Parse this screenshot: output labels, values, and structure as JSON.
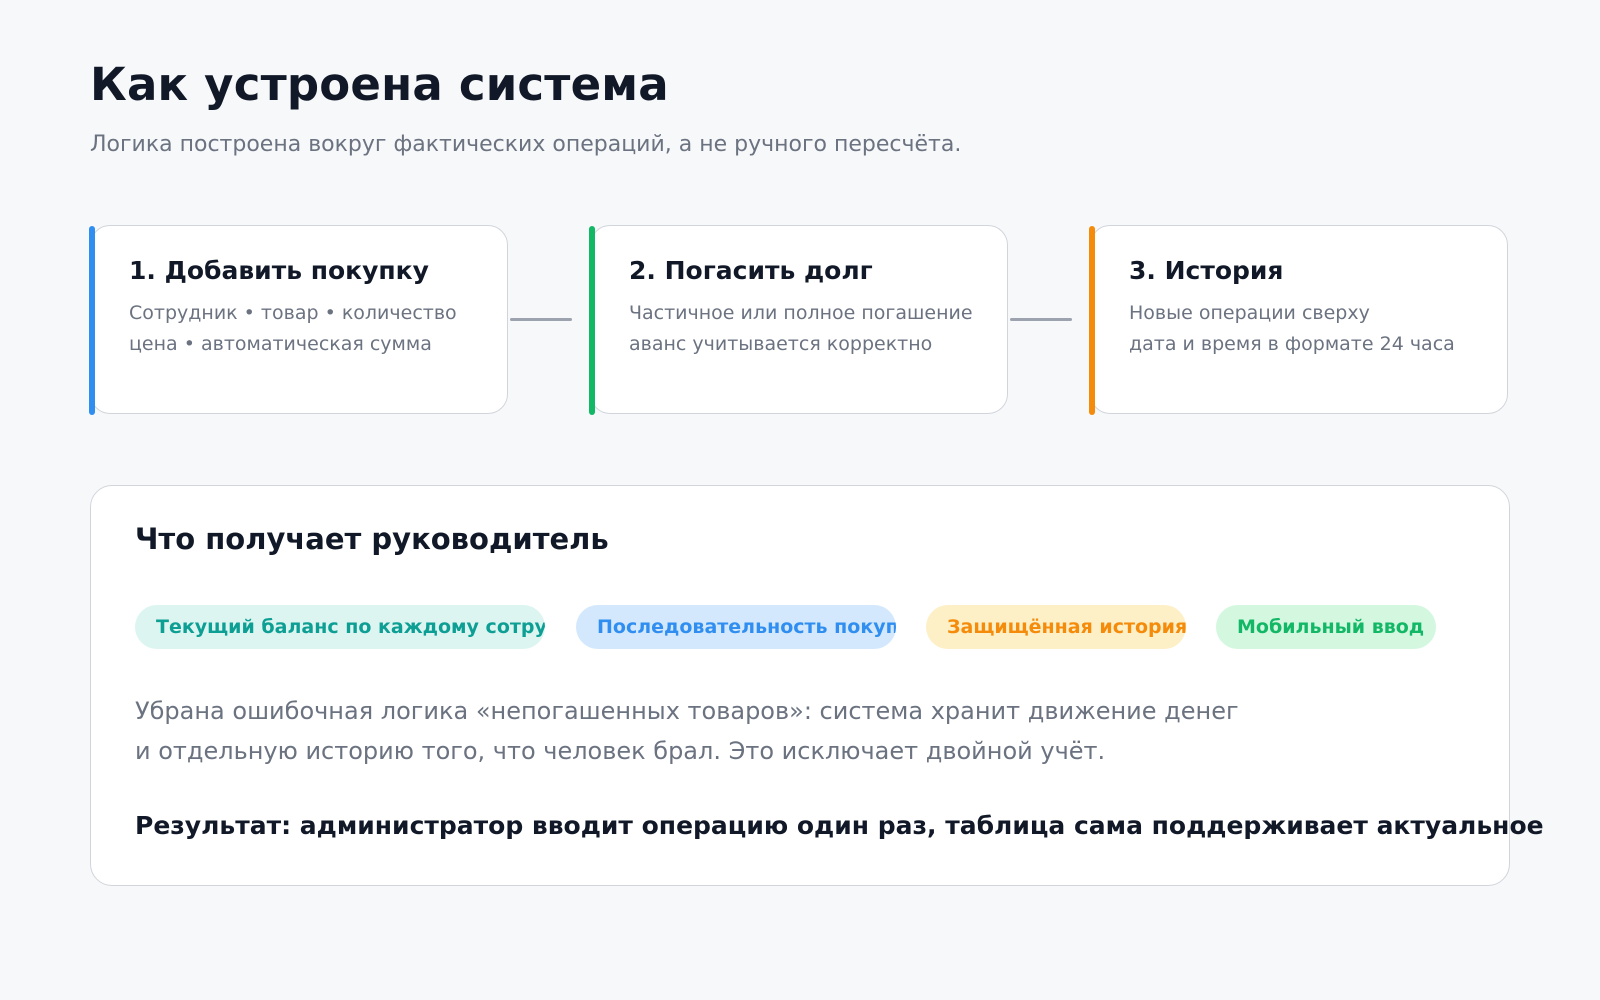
{
  "header": {
    "title": "Как устроена система",
    "subtitle": "Логика построена вокруг фактических операций, а не ручного пересчёта."
  },
  "steps": [
    {
      "title": "1. Добавить покупку",
      "line1": "Сотрудник • товар • количество",
      "line2": "цена • автоматическая сумма",
      "color": "#2f8ef0"
    },
    {
      "title": "2. Погасить долг",
      "line1": "Частичное или полное погашение",
      "line2": "аванс учитывается корректно",
      "color": "#12b866"
    },
    {
      "title": "3. История",
      "line1": "Новые операции сверху",
      "line2": "дата и время в формате 24 часа",
      "color": "#f58b0a"
    }
  ],
  "panel": {
    "title": "Что получает руководитель",
    "tags": [
      {
        "label": "Текущий баланс по каждому сотруднику",
        "color": "#0d9e94",
        "bg": "#dcf5f1"
      },
      {
        "label": "Последовательность покупок",
        "color": "#2f8ef0",
        "bg": "#d3e8fd"
      },
      {
        "label": "Защищённая история",
        "color": "#f58b0a",
        "bg": "#fdefc6"
      },
      {
        "label": "Мобильный ввод",
        "color": "#12b866",
        "bg": "#d3f7df"
      }
    ],
    "paragraph_line1": "Убрана ошибочная логика «непогашенных товаров»: система хранит движение денег",
    "paragraph_line2": "и отдельную историю того, что человек брал. Это исключает двойной учёт.",
    "result": "Результат: администратор вводит операцию один раз, таблица сама поддерживает актуальное"
  }
}
